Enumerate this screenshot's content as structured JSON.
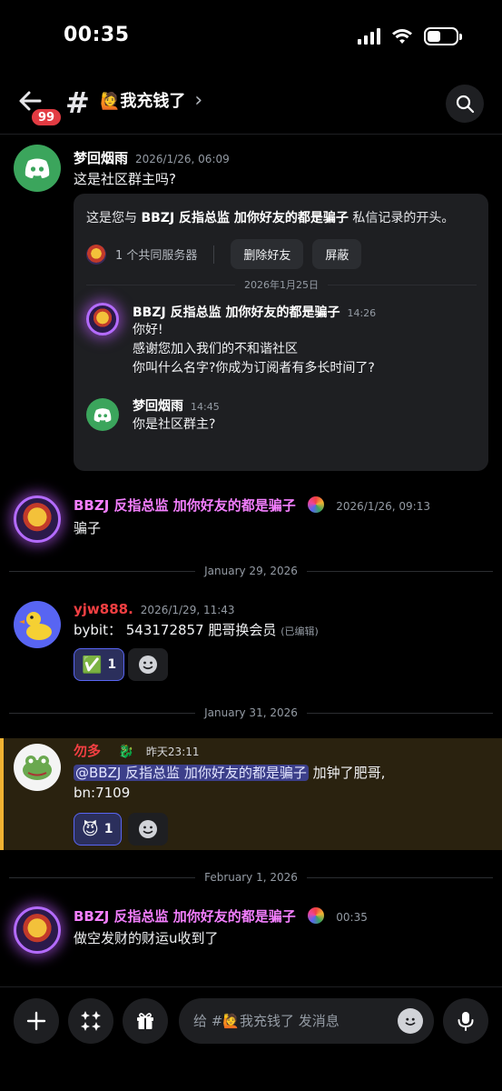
{
  "status": {
    "time": "00:35"
  },
  "header": {
    "back_badge": "99",
    "channel_name": "🙋我充钱了",
    "chevron": "›"
  },
  "messages": [
    {
      "author": "梦回烟雨",
      "author_color": "#ffffff",
      "timestamp": "2026/1/26, 06:09",
      "text": "这是社区群主吗?",
      "embed": {
        "title_prefix": "这是您与",
        "title_name": "BBZJ 反指总监 加你好友的都是骗子",
        "title_suffix": "私信记录的开头。",
        "servers_label": "1 个共同服务器",
        "remove_friend_label": "删除好友",
        "block_label": "屏蔽",
        "date_divider": "2026年1月25日",
        "dm_messages": [
          {
            "author": "BBZJ 反指总监 加你好友的都是骗子",
            "time": "14:26",
            "lines": [
              "你好!",
              "感谢您加入我们的不和谐社区",
              "你叫什么名字?你成为订阅者有多长时间了?"
            ]
          },
          {
            "author": "梦回烟雨",
            "time": "14:45",
            "lines": [
              "你是社区群主?"
            ]
          }
        ]
      }
    },
    {
      "author": "BBZJ 反指总监 加你好友的都是骗子",
      "author_color": "#f47fff",
      "timestamp": "2026/1/26, 09:13",
      "text": "骗子"
    },
    {
      "author": "yjw888.",
      "author_color": "#f23f42",
      "timestamp": "2026/1/29, 11:43",
      "text": "bybit： 543172857 肥哥换会员",
      "edited": "(已编辑)",
      "reaction": {
        "emoji": "✅",
        "count": "1"
      }
    },
    {
      "author": "勿多",
      "author_color": "#f23f42",
      "timestamp": "昨天23:11",
      "mention": "@BBZJ 反指总监 加你好友的都是骗子",
      "text_after_mention": "加钟了肥哥,",
      "text_line2": "bn:7109",
      "reaction": {
        "emoji": "😈",
        "count": "1"
      }
    },
    {
      "author": "BBZJ 反指总监 加你好友的都是骗子",
      "author_color": "#f47fff",
      "timestamp": "00:35",
      "text": "做空发财的财运u收到了"
    }
  ],
  "dividers": [
    "January 29, 2026",
    "January 31, 2026",
    "February 1, 2026"
  ],
  "composer": {
    "placeholder": "给 #🙋我充钱了 发消息"
  },
  "colors": {
    "accent": "#5865f2",
    "mention_bar": "#f0b232",
    "background": "#000000"
  }
}
